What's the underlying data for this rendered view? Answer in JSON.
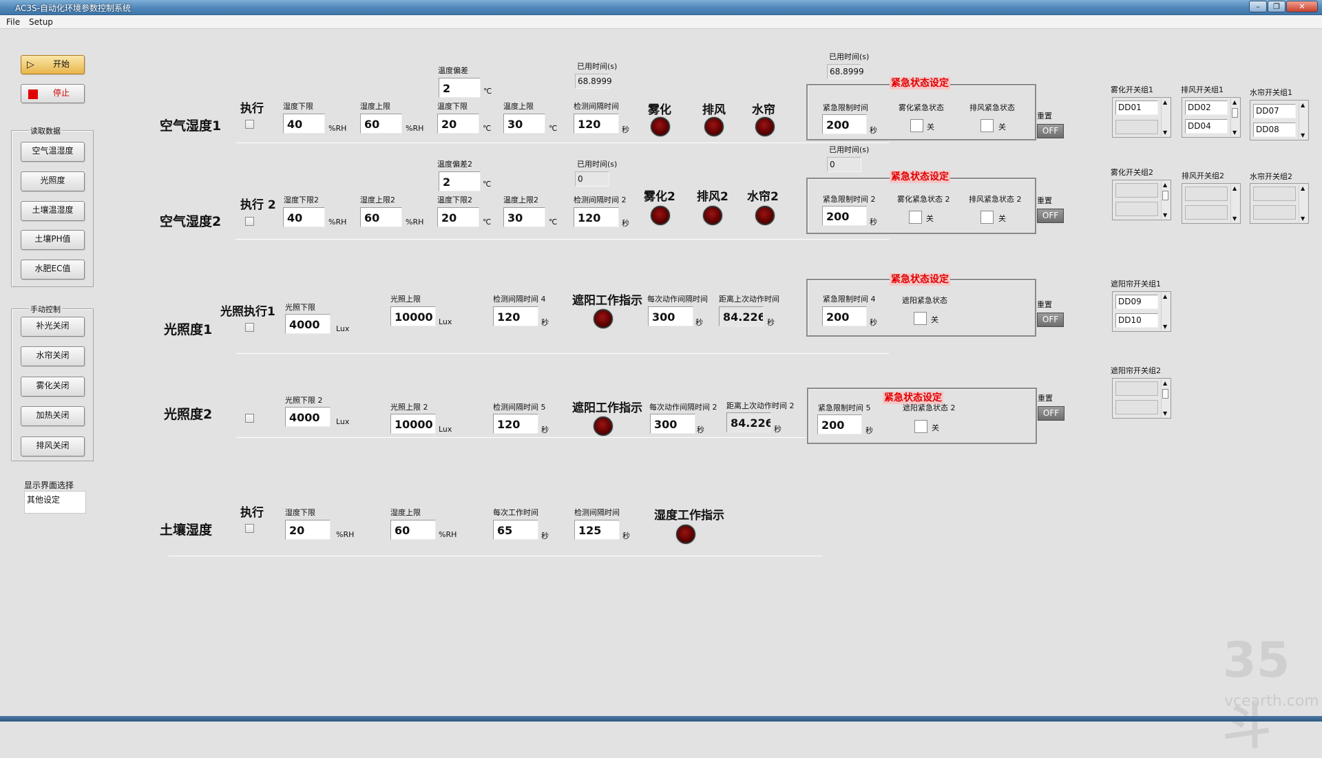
{
  "window": {
    "title": "AC3S-自动化环境参数控制系统"
  },
  "menu": {
    "file": "File",
    "setup": "Setup"
  },
  "controls": {
    "start": "开始",
    "stop": "停止"
  },
  "read_data": {
    "title": "读取数据",
    "buttons": [
      "空气温湿度",
      "光照度",
      "土壤温湿度",
      "土壤PH值",
      "水肥EC值"
    ]
  },
  "manual": {
    "title": "手动控制",
    "buttons": [
      "补光关闭",
      "水帘关闭",
      "雾化关闭",
      "加热关闭",
      "排风关闭"
    ]
  },
  "display": {
    "title": "显示界面选择",
    "value": "其他设定"
  },
  "air1": {
    "name": "空气湿度1",
    "exec": "执行",
    "hum_low_label": "湿度下限",
    "hum_low": "40",
    "hum_high_label": "湿度上限",
    "hum_high": "60",
    "temp_dev_label": "温度偏差",
    "temp_dev": "2",
    "temp_low_label": "温度下限",
    "temp_low": "20",
    "temp_high_label": "温度上限",
    "temp_high": "30",
    "elapsed_label": "已用时间(s)",
    "elapsed": "68.8999",
    "interval_label": "检测间隔时间",
    "interval": "120",
    "fog": "雾化",
    "fan": "排风",
    "curtain": "水帘",
    "em_elapsed_label": "已用时间(s)",
    "em_elapsed": "68.8999",
    "em_title": "紧急状态设定",
    "em_time_label": "紧急限制时间",
    "em_time": "200",
    "em_fog_label": "雾化紧急状态",
    "em_fan_label": "排风紧急状态",
    "reset": "重置",
    "off": "OFF"
  },
  "air2": {
    "name": "空气湿度2",
    "exec": "执行 2",
    "hum_low_label": "湿度下限2",
    "hum_low": "40",
    "hum_high_label": "湿度上限2",
    "hum_high": "60",
    "temp_dev_label": "温度偏差2",
    "temp_dev": "2",
    "temp_low_label": "温度下限2",
    "temp_low": "20",
    "temp_high_label": "温度上限2",
    "temp_high": "30",
    "elapsed_label": "已用时间(s)",
    "elapsed": "0",
    "interval_label": "检测间隔时间 2",
    "interval": "120",
    "fog": "雾化2",
    "fan": "排风2",
    "curtain": "水帘2",
    "em_elapsed_label": "已用时间(s)",
    "em_elapsed": "0",
    "em_title": "紧急状态设定",
    "em_time_label": "紧急限制时间 2",
    "em_time": "200",
    "em_fog_label": "雾化紧急状态 2",
    "em_fan_label": "排风紧急状态 2",
    "reset": "重置",
    "off": "OFF"
  },
  "light1": {
    "name": "光照度1",
    "exec": "光照执行1",
    "low_label": "光照下限",
    "low": "4000",
    "high_label": "光照上限",
    "high": "10000",
    "interval_label": "检测间隔时间 4",
    "interval": "120",
    "shade": "遮阳工作指示",
    "action_label": "每次动作间隔时间",
    "action": "300",
    "since_label": "距离上次动作时间",
    "since": "84.226",
    "em_title": "紧急状态设定",
    "em_time_label": "紧急限制时间 4",
    "em_time": "200",
    "em_shade_label": "遮阳紧急状态",
    "reset": "重置",
    "off": "OFF"
  },
  "light2": {
    "name": "光照度2",
    "low_label": "光照下限 2",
    "low": "4000",
    "high_label": "光照上限 2",
    "high": "10000",
    "interval_label": "检测间隔时间 5",
    "interval": "120",
    "shade": "遮阳工作指示",
    "action_label": "每次动作间隔时间 2",
    "action": "300",
    "since_label": "距离上次动作时间 2",
    "since": "84.226",
    "em_title": "紧急状态设定",
    "em_time_label": "紧急限制时间 5",
    "em_time": "200",
    "em_shade_label": "遮阳紧急状态 2",
    "reset": "重置",
    "off": "OFF"
  },
  "soil": {
    "name": "土壤湿度",
    "exec": "执行",
    "hum_low_label": "湿度下限",
    "hum_low": "20",
    "hum_high_label": "湿度上限",
    "hum_high": "60",
    "work_label": "每次工作时间",
    "work": "65",
    "interval_label": "检测间隔时间",
    "interval": "125",
    "indicator": "湿度工作指示"
  },
  "units": {
    "rh": "%RH",
    "c": "℃",
    "sec": "秒",
    "lux": "Lux",
    "off_text": "关"
  },
  "switch_groups": {
    "fog1": {
      "title": "雾化开关组1",
      "items": [
        "DD01",
        ""
      ]
    },
    "fan1": {
      "title": "排风开关组1",
      "items": [
        "DD02",
        "DD04"
      ]
    },
    "curtain1": {
      "title": "水帘开关组1",
      "items": [
        "DD07",
        "DD08"
      ]
    },
    "fog2": {
      "title": "雾化开关组2"
    },
    "fan2": {
      "title": "排风开关组2"
    },
    "curtain2": {
      "title": "水帘开关组2"
    },
    "shade1": {
      "title": "遮阳帘开关组1",
      "items": [
        "DD09",
        "DD10"
      ]
    },
    "shade2": {
      "title": "遮阳帘开关组2"
    }
  },
  "watermark": {
    "logo": "35斗",
    "site": "vcearth.com"
  }
}
